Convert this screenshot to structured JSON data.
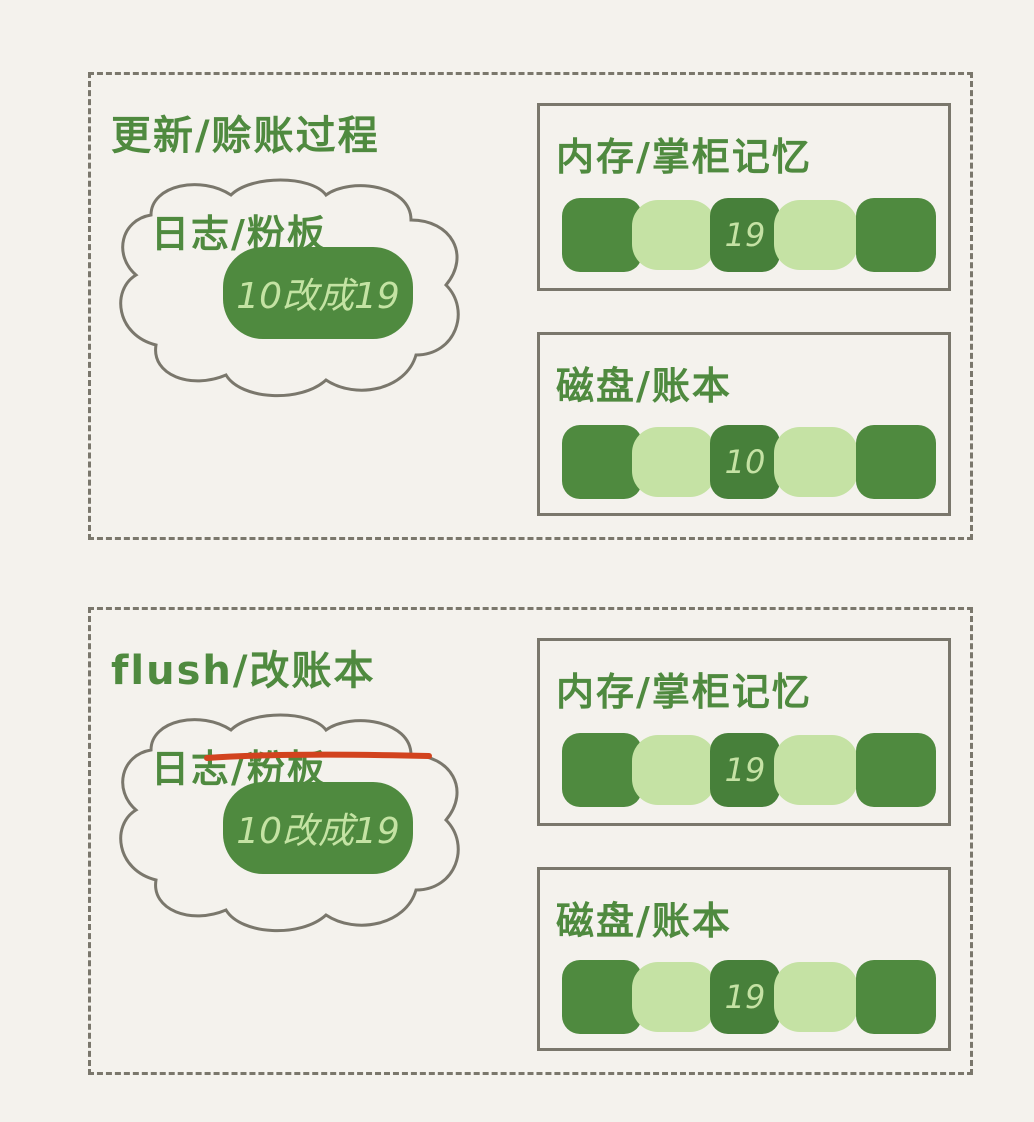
{
  "panels": [
    {
      "title": "更新/赊账过程",
      "log": {
        "title": "日志/粉板",
        "entry": "10改成19",
        "struck": false
      },
      "memory": {
        "title": "内存/掌柜记忆",
        "value": "19"
      },
      "disk": {
        "title": "磁盘/账本",
        "value": "10"
      }
    },
    {
      "title": "flush/改账本",
      "log": {
        "title": "日志/粉板",
        "entry": "10改成19",
        "struck": true
      },
      "memory": {
        "title": "内存/掌柜记忆",
        "value": "19"
      },
      "disk": {
        "title": "磁盘/账本",
        "value": "19"
      }
    }
  ],
  "colors": {
    "dark_green": "#4f8a3f",
    "light_green": "#c5e2a4",
    "border": "#7a776c",
    "strike": "#d2431e",
    "background": "#f4f2ed"
  }
}
